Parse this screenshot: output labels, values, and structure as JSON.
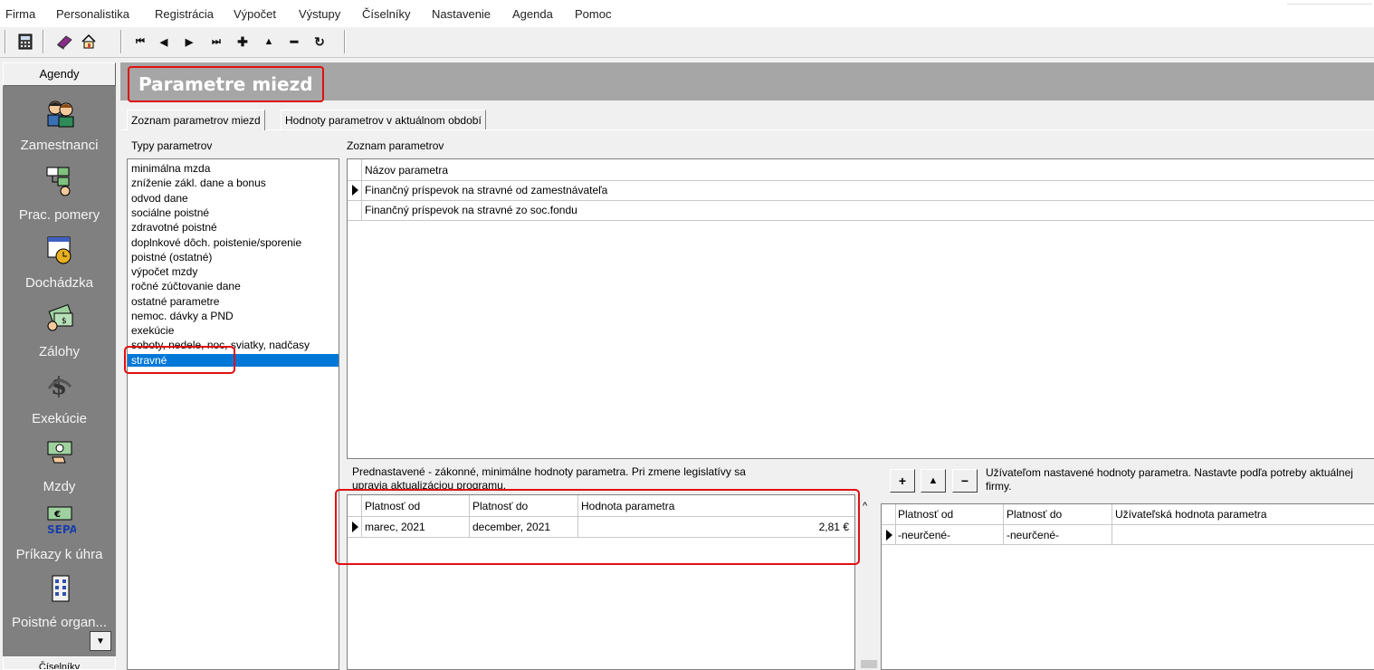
{
  "menu": [
    "Firma",
    "Personalistika",
    "Registrácia",
    "Výpočet",
    "Výstupy",
    "Číselníky",
    "Nastavenie",
    "Agenda",
    "Pomoc"
  ],
  "toolbar": {
    "icons": [
      "calculator-icon",
      "book-icon",
      "home-icon",
      "first-record-icon",
      "prev-record-icon",
      "next-record-icon",
      "last-record-icon",
      "add-record-icon",
      "edit-record-icon",
      "delete-record-icon",
      "refresh-icon"
    ],
    "nav_glyphs": [
      "⏮",
      "◀",
      "▶",
      "⏭",
      "✚",
      "▲",
      "━",
      "↻"
    ]
  },
  "sidebar": {
    "header": "Agendy",
    "items": [
      {
        "label": "Zamestnanci",
        "icon": "employees-icon"
      },
      {
        "label": "Prac. pomery",
        "icon": "work-relations-icon"
      },
      {
        "label": "Dochádzka",
        "icon": "attendance-icon"
      },
      {
        "label": "Zálohy",
        "icon": "advances-icon"
      },
      {
        "label": "Exekúcie",
        "icon": "garnishment-icon"
      },
      {
        "label": "Mzdy",
        "icon": "wages-icon"
      },
      {
        "label": "Príkazy k úhra",
        "icon": "sepa-icon",
        "icon_text": "SEPA"
      },
      {
        "label": "Poistné organ...",
        "icon": "insurance-org-icon"
      }
    ],
    "bottom_button": "Číselníky"
  },
  "header": {
    "title": "Parametre miezd"
  },
  "tabs": [
    "Zoznam parametrov miezd",
    "Hodnoty parametrov v aktuálnom období"
  ],
  "types": {
    "label": "Typy parametrov",
    "items": [
      "minimálna mzda",
      "zníženie zákl. dane a bonus",
      "odvod dane",
      "sociálne poistné",
      "zdravotné poistné",
      "doplnkové dôch. poistenie/sporenie",
      "poistné (ostatné)",
      "výpočet mzdy",
      "ročné zúčtovanie dane",
      "ostatné parametre",
      "nemoc. dávky a PND",
      "exekúcie",
      "soboty, nedele, noc, sviatky, nadčasy",
      "stravné"
    ],
    "selected_index": 13
  },
  "params": {
    "label": "Zoznam parametrov",
    "column": "Názov parametra",
    "rows": [
      "Finančný príspevok na stravné od zamestnávateľa",
      "Finančný príspevok na stravné zo soc.fondu"
    ]
  },
  "defaults": {
    "note": "Prednastavené - zákonné, minimálne hodnoty parametra. Pri zmene legislatívy sa upravia aktualizáciou programu.",
    "columns": [
      "Platnosť od",
      "Platnosť do",
      "Hodnota parametra"
    ],
    "rows": [
      {
        "from": "marec, 2021",
        "to": "december, 2021",
        "value": "2,81 €"
      }
    ]
  },
  "user_values": {
    "note": "Užívateľom nastavené hodnoty parametra. Nastavte podľa potreby aktuálnej firmy.",
    "buttons": [
      "+",
      "▲",
      "−"
    ],
    "columns": [
      "Platnosť od",
      "Platnosť do",
      "Užívateľská hodnota parametra"
    ],
    "rows": [
      {
        "from": "-neurčené-",
        "to": "-neurčené-",
        "value": ""
      }
    ]
  },
  "colors": {
    "highlight": "#e01010",
    "selection": "#0078d7",
    "sidebar": "#808080",
    "header": "#a6a6a6"
  }
}
